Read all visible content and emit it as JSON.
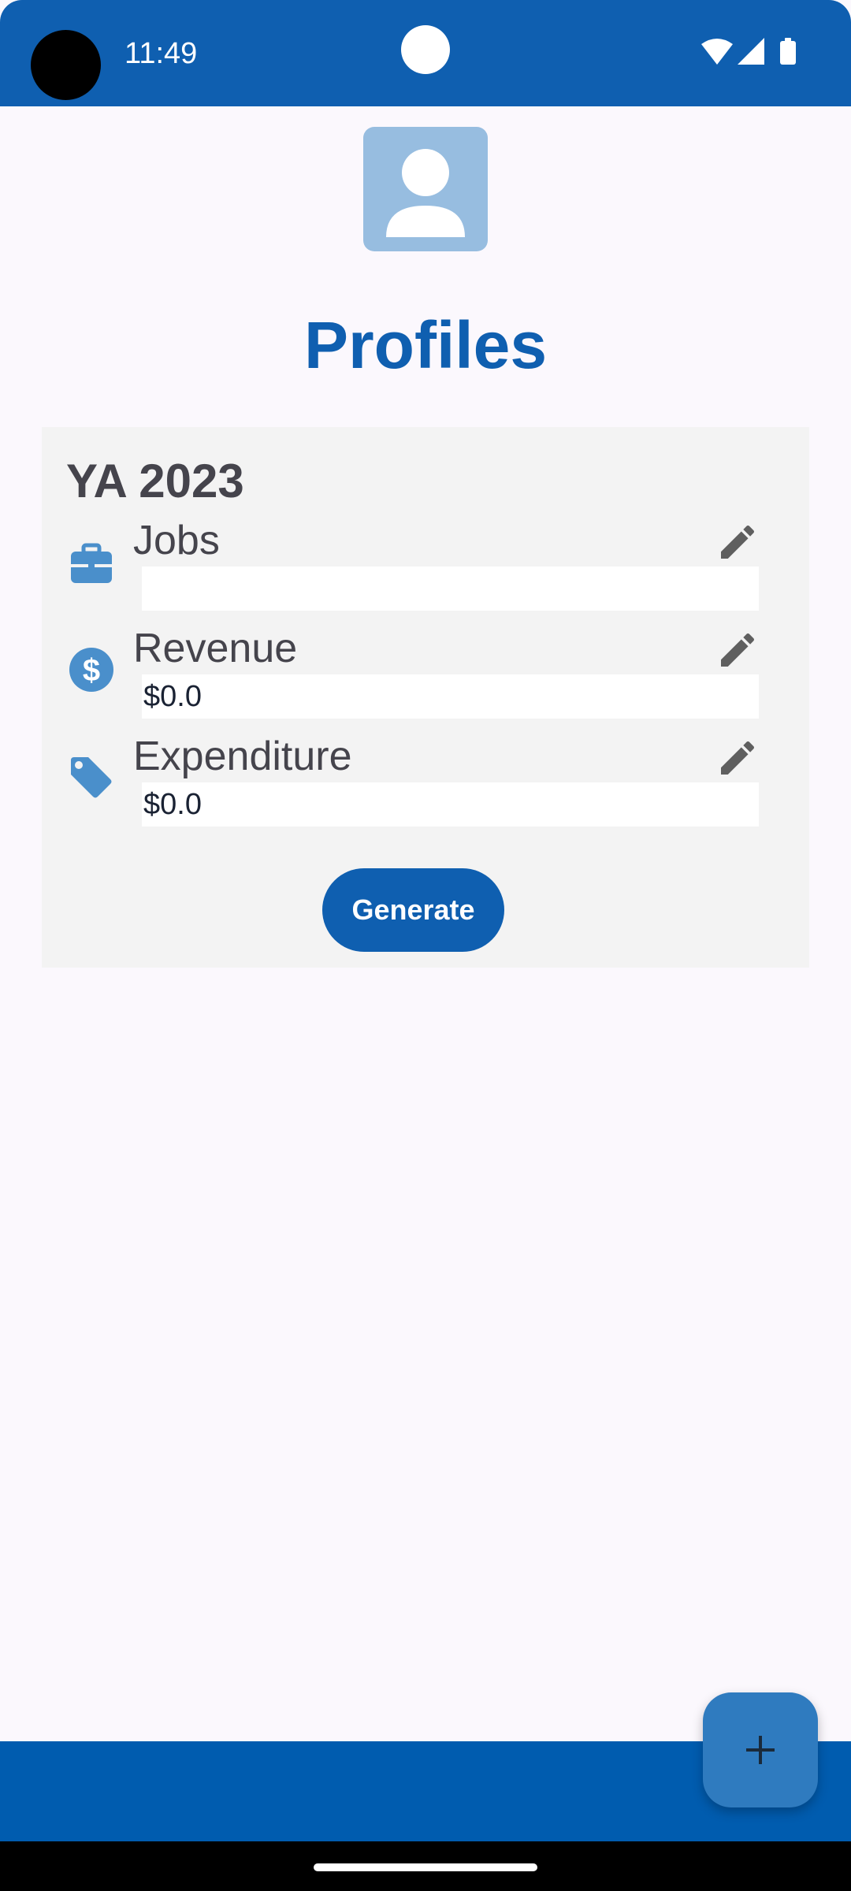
{
  "status_bar": {
    "time": "11:49",
    "icons": [
      "wifi-icon",
      "signal-icon",
      "battery-icon"
    ]
  },
  "header": {
    "avatar_icon": "person-icon",
    "title": "Profiles"
  },
  "card": {
    "title": "YA 2023",
    "rows": [
      {
        "icon": "briefcase-icon",
        "label": "Jobs",
        "value": "",
        "edit_icon": "pencil-icon"
      },
      {
        "icon": "dollar-circle-icon",
        "label": "Revenue",
        "value": "$0.0",
        "edit_icon": "pencil-icon"
      },
      {
        "icon": "tag-icon",
        "label": "Expenditure",
        "value": "$0.0",
        "edit_icon": "pencil-icon"
      }
    ],
    "generate_label": "Generate"
  },
  "fab": {
    "icon": "plus-icon"
  },
  "colors": {
    "primary": "#0F5FB0",
    "bottom_bar": "#005CAF",
    "icon_blue": "#4A8FCB",
    "fab": "#2F7BBF",
    "avatar_bg": "#97BDE0",
    "background": "#FBF8FD",
    "card_bg": "#F3F3F3"
  }
}
